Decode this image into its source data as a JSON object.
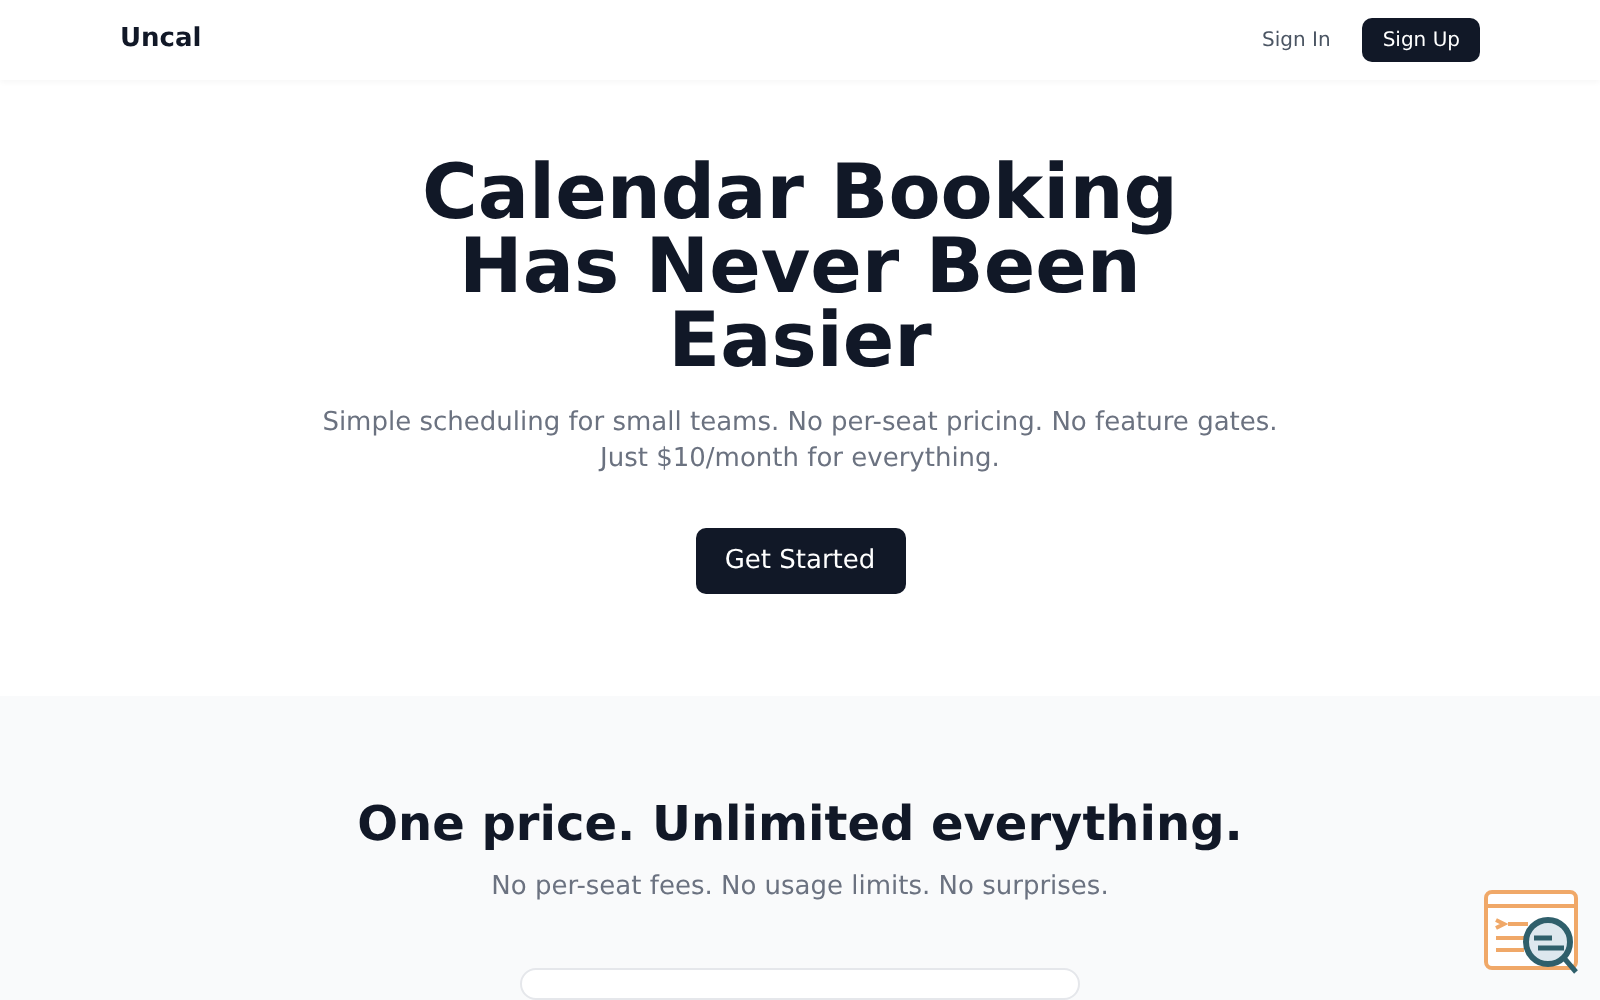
{
  "header": {
    "logo": "Uncal",
    "sign_in": "Sign In",
    "sign_up": "Sign Up"
  },
  "hero": {
    "title_lines": [
      "Calendar Booking",
      "Has Never Been",
      "Easier"
    ],
    "subtitle_lines": [
      "Simple scheduling for small teams. No per-seat pricing. No feature gates.",
      "Just $10/month for everything."
    ],
    "cta": "Get Started"
  },
  "pricing": {
    "title": "One price. Unlimited everything.",
    "subtitle": "No per-seat fees. No usage limits. No surprises."
  }
}
